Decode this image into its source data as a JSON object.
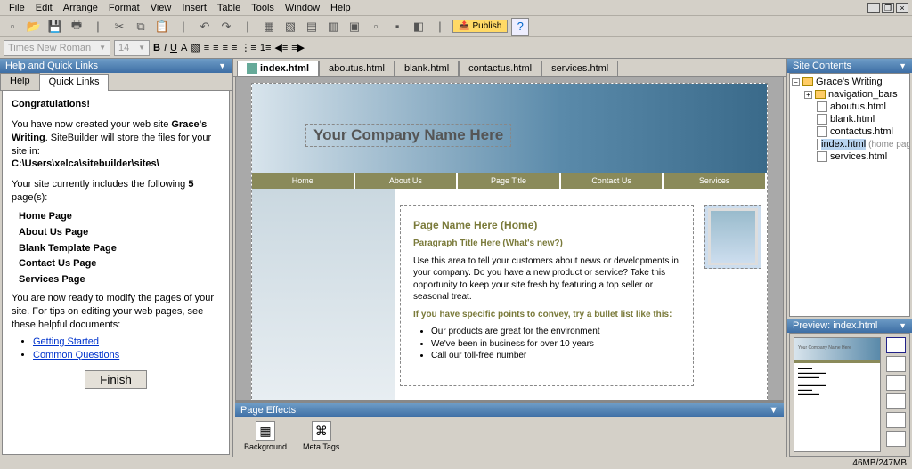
{
  "menu": [
    "File",
    "Edit",
    "Arrange",
    "Format",
    "View",
    "Insert",
    "Table",
    "Tools",
    "Window",
    "Help"
  ],
  "publish_label": "Publish",
  "font_combo": "Times New Roman",
  "size_combo": "14",
  "left_panel": {
    "title": "Help and Quick Links",
    "tabs": [
      "Help",
      "Quick Links"
    ],
    "congrats": "Congratulations!",
    "intro1a": "You have now created your web site ",
    "intro1b": "Grace's Writing",
    "intro1c": ". SiteBuilder will store the files for your site in:",
    "path": "C:\\Users\\xelca\\sitebuilder\\sites\\",
    "intro2a": "Your site currently includes the following ",
    "intro2b": "5",
    "intro2c": " page(s):",
    "pages": [
      "Home Page",
      "About Us Page",
      "Blank Template Page",
      "Contact Us Page",
      "Services Page"
    ],
    "ready": "You are now ready to modify the pages of your site. For tips on editing your web pages, see these helpful documents:",
    "links": [
      "Getting Started",
      "Common Questions"
    ],
    "finish": "Finish"
  },
  "doc_tabs": [
    "index.html",
    "aboutus.html",
    "blank.html",
    "contactus.html",
    "services.html"
  ],
  "canvas": {
    "company": "Your Company Name Here",
    "nav": [
      "Home",
      "About Us",
      "Page Title",
      "Contact Us",
      "Services"
    ],
    "page_name": "Page Name Here (Home)",
    "para_title": "Paragraph Title Here (What's new?)",
    "body_text": "Use this area to tell your customers about news or developments in your company. Do you have a new product or service? Take this opportunity to keep your site fresh by featuring a top seller or seasonal treat.",
    "bullet_intro": "If you have specific points to convey, try a bullet list like this:",
    "bullets": [
      "Our products are great for the environment",
      "We've been in business for over 10 years",
      "Call our toll-free number"
    ]
  },
  "page_effects": {
    "title": "Page Effects",
    "items": [
      "Background",
      "Meta Tags"
    ]
  },
  "site_contents": {
    "title": "Site Contents",
    "root": "Grace's Writing",
    "folder": "navigation_bars",
    "files": [
      "aboutus.html",
      "blank.html",
      "contactus.html",
      "index.html",
      "services.html"
    ],
    "selected_hint": "(home page)"
  },
  "preview": {
    "title": "Preview: index.html"
  },
  "status": "46MB/247MB"
}
